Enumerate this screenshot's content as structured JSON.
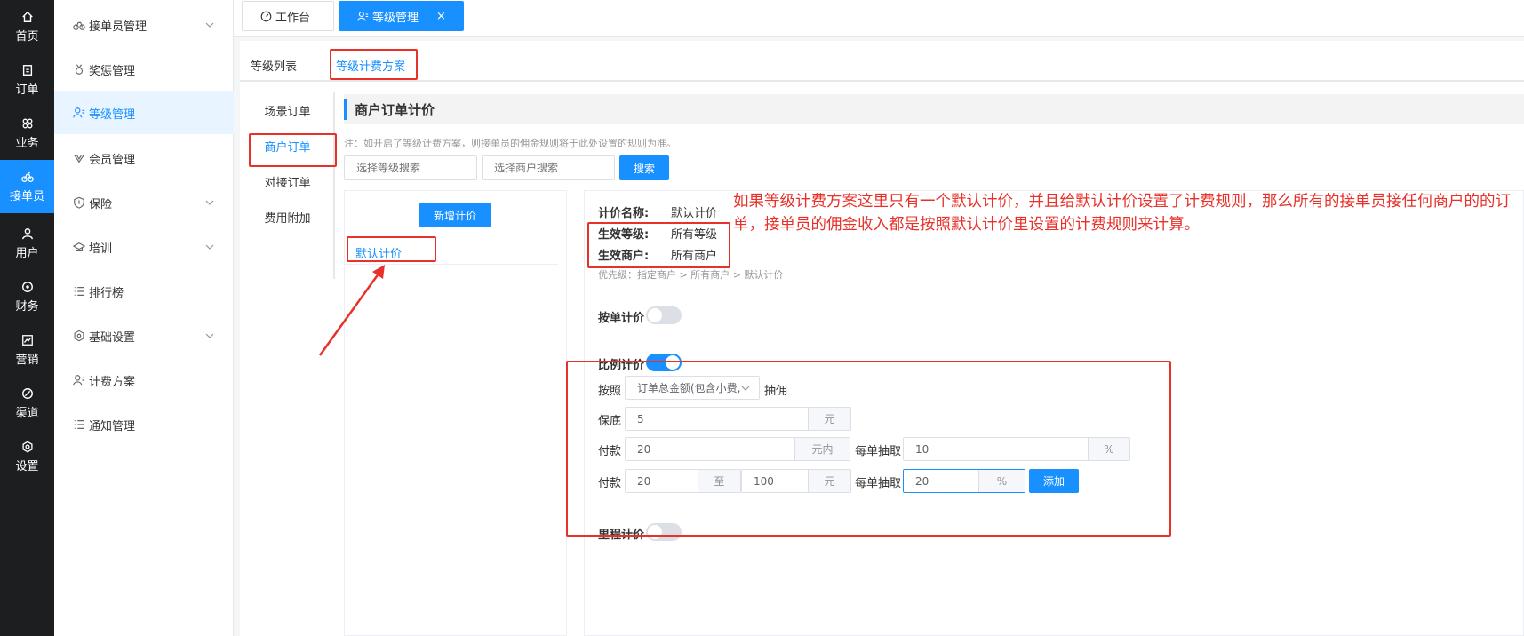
{
  "rail": {
    "items": [
      {
        "label": "首页",
        "icon": "home-icon"
      },
      {
        "label": "订单",
        "icon": "order-icon"
      },
      {
        "label": "业务",
        "icon": "business-icon"
      },
      {
        "label": "接单员",
        "icon": "courier-icon"
      },
      {
        "label": "用户",
        "icon": "user-icon"
      },
      {
        "label": "财务",
        "icon": "finance-icon"
      },
      {
        "label": "营销",
        "icon": "marketing-icon"
      },
      {
        "label": "渠道",
        "icon": "channel-icon"
      },
      {
        "label": "设置",
        "icon": "settings-icon"
      }
    ]
  },
  "menu": {
    "items": [
      {
        "label": "接单员管理",
        "icon": "bike-icon"
      },
      {
        "label": "奖惩管理",
        "icon": "medal-icon"
      },
      {
        "label": "等级管理",
        "icon": "user-list-icon"
      },
      {
        "label": "会员管理",
        "icon": "vip-icon"
      },
      {
        "label": "保险",
        "icon": "shield-icon"
      },
      {
        "label": "培训",
        "icon": "training-icon"
      },
      {
        "label": "排行榜",
        "icon": "list-icon"
      },
      {
        "label": "基础设置",
        "icon": "hexagon-icon"
      },
      {
        "label": "计费方案",
        "icon": "user-list-icon"
      },
      {
        "label": "通知管理",
        "icon": "list-icon"
      }
    ]
  },
  "topbar": {
    "tabs": [
      {
        "label": "工作台",
        "icon": "dashboard-icon"
      },
      {
        "label": "等级管理",
        "icon": "user-list-icon",
        "close": "×"
      }
    ]
  },
  "subtabs": [
    "等级列表",
    "等级计费方案"
  ],
  "vtabs": [
    "场景订单",
    "商户订单",
    "对接订单",
    "费用附加"
  ],
  "section": {
    "title": "商户订单计价",
    "note": "注：如开启了等级计费方案，则接单员的佣金规则将于此处设置的规则为准。"
  },
  "search": {
    "level_placeholder": "选择等级搜索",
    "merchant_placeholder": "选择商户搜索",
    "button": "搜索"
  },
  "pricing_list": {
    "add_button": "新增计价",
    "items": [
      "默认计价"
    ]
  },
  "detail": {
    "name_label": "计价名称:",
    "name_value": "默认计价",
    "level_label": "生效等级:",
    "level_value": "所有等级",
    "merchant_label": "生效商户:",
    "merchant_value": "所有商户",
    "priority_hint": "优先级：指定商户 > 所有商户 > 默认计价",
    "per_order_label": "按单计价",
    "per_order_on": false,
    "ratio_label": "比例计价",
    "ratio_on": true,
    "by_label": "按照",
    "by_select": "订单总金额(包含小费,",
    "commission_label": "抽佣",
    "min_label": "保底",
    "min_value": "5",
    "min_unit": "元",
    "pay_label": "付款",
    "pay1_value": "20",
    "pay1_unit": "元内",
    "each_label": "每单抽取",
    "each1_value": "10",
    "percent_unit": "%",
    "pay2_from": "20",
    "pay2_to_label": "至",
    "pay2_to": "100",
    "pay2_unit": "元",
    "each2_value": "20",
    "add_button": "添加",
    "mileage_label": "里程计价",
    "mileage_on": false
  },
  "annotation": {
    "text": "如果等级计费方案这里只有一个默认计价，并且给默认计价设置了计费规则，那么所有的接单员接任何商户的的订单，接单员的佣金收入都是按照默认计价里设置的计费规则来计算。"
  },
  "colors": {
    "accent": "#1890ff",
    "annotation_red": "#e8312a",
    "rail_bg": "#1d1e20"
  }
}
